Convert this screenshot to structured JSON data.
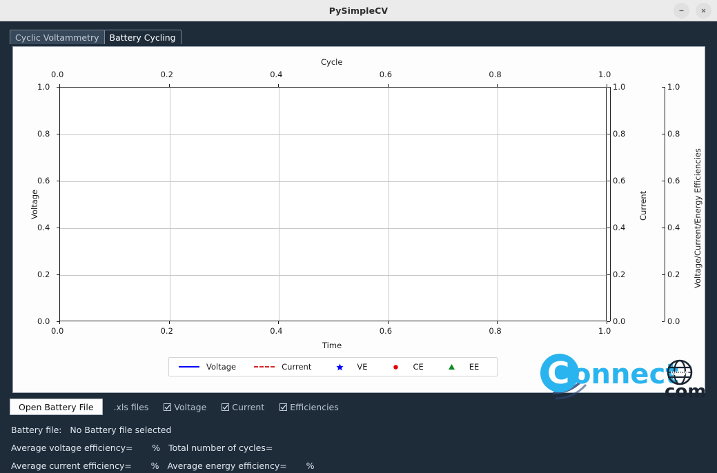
{
  "window": {
    "title": "PySimpleCV",
    "minimize_label": "minimize",
    "close_label": "close"
  },
  "tabs": [
    {
      "label": "Cyclic Voltammetry",
      "active": false
    },
    {
      "label": "Battery Cycling",
      "active": true
    }
  ],
  "chart_data": {
    "type": "line",
    "title": "",
    "series": [
      {
        "name": "Voltage",
        "style": "solid line",
        "color": "#0000ff",
        "values": []
      },
      {
        "name": "Current",
        "style": "dashed line",
        "color": "#d62728",
        "values": []
      },
      {
        "name": "VE",
        "style": "star marker",
        "color": "#0000ff",
        "values": []
      },
      {
        "name": "CE",
        "style": "dot marker",
        "color": "#d62728",
        "values": []
      },
      {
        "name": "EE",
        "style": "triangle marker",
        "color": "#008000",
        "values": []
      }
    ],
    "x": [],
    "xlabel": "Time",
    "ylabel": "Voltage",
    "top_axis_label": "Cycle",
    "right_axis_label": "Current",
    "right_axis2_label": "Voltage/Current/Energy Efficiencies",
    "xlim": [
      0.0,
      1.0
    ],
    "ylim": [
      0.0,
      1.0
    ],
    "xticks": [
      "0.0",
      "0.2",
      "0.4",
      "0.6",
      "0.8",
      "1.0"
    ],
    "yticks": [
      "0.0",
      "0.2",
      "0.4",
      "0.6",
      "0.8",
      "1.0"
    ],
    "top_xticks": [
      "0.0",
      "0.2",
      "0.4",
      "0.6",
      "0.8",
      "1.0"
    ],
    "right_yticks": [
      "0.0",
      "0.2",
      "0.4",
      "0.6",
      "0.8",
      "1.0"
    ],
    "right_yticks2": [
      "0.0",
      "0.2",
      "0.4",
      "0.6",
      "0.8",
      "1.0"
    ],
    "grid": true,
    "legend_position": "below axes",
    "legend": [
      "Voltage",
      "Current",
      "VE",
      "CE",
      "EE"
    ],
    "empty": true
  },
  "watermark": {
    "text_main": "onnect",
    "text_c": "C",
    "text_www": "www",
    "text_com": "com"
  },
  "controls": {
    "open_button": "Open Battery File",
    "file_type_label": ".xls files",
    "checkboxes": [
      {
        "label": "Voltage",
        "checked": true
      },
      {
        "label": "Current",
        "checked": true
      },
      {
        "label": "Efficiencies",
        "checked": true
      }
    ]
  },
  "status": {
    "line1": "Battery file:   No Battery file selected",
    "line2": "Average voltage efficiency=       %   Total number of cycles=",
    "line3": "Average current efficiency=       %   Average energy efficiency=       %"
  },
  "colors": {
    "window_bg": "#1e2c3a",
    "titlebar_bg": "#ebebeb",
    "canvas_bg": "#fdfdfd",
    "voltage": "#0000ff",
    "current": "#d62728",
    "efficiency": "#008000"
  }
}
